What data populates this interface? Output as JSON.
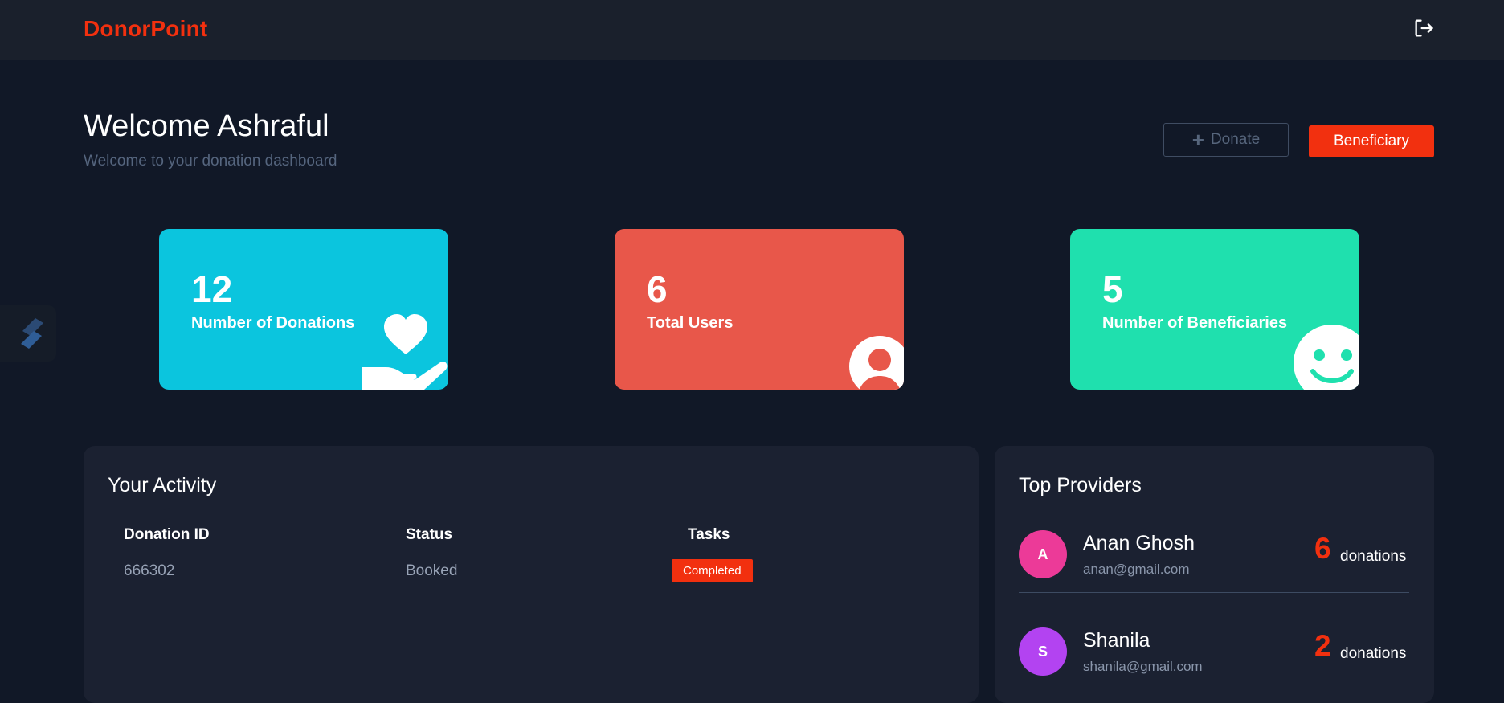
{
  "app": {
    "brand": "DonorPoint"
  },
  "header": {
    "logout_icon": "logout-icon"
  },
  "welcome": {
    "title": "Welcome Ashraful",
    "subtitle": "Welcome to your donation dashboard"
  },
  "actions": {
    "donate_label": "Donate",
    "beneficiary_label": "Beneficiary"
  },
  "stats": [
    {
      "value": "12",
      "label": "Number of Donations",
      "color": "#0bc5de",
      "icon": "heart-hand-icon"
    },
    {
      "value": "6",
      "label": "Total Users",
      "color": "#e8574a",
      "icon": "user-icon"
    },
    {
      "value": "5",
      "label": "Number of Beneficiaries",
      "color": "#1fe0ae",
      "icon": "smile-icon"
    }
  ],
  "activity": {
    "title": "Your Activity",
    "columns": [
      "Donation ID",
      "Status",
      "Tasks"
    ],
    "rows": [
      {
        "id": "666302",
        "status": "Booked",
        "task": "Completed"
      }
    ]
  },
  "providers": {
    "title": "Top Providers",
    "items": [
      {
        "initial": "A",
        "name": "Anan Ghosh",
        "email": "anan@gmail.com",
        "count": "6",
        "unit": "donations",
        "color": "#ec3a98"
      },
      {
        "initial": "S",
        "name": "Shanila",
        "email": "shanila@gmail.com",
        "count": "2",
        "unit": "donations",
        "color": "#b343f1"
      }
    ]
  },
  "colors": {
    "accent": "#f2300f",
    "background": "#111827",
    "topbar": "#1a202c",
    "panel": "#1b2131"
  }
}
